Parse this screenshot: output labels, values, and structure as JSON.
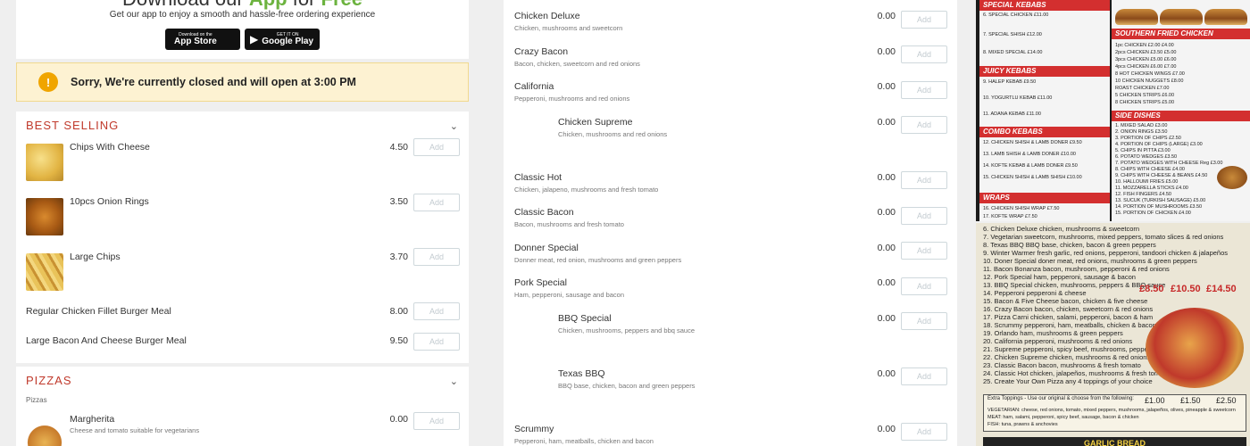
{
  "app_banner": {
    "title_prefix": "Download our",
    "title_app": "App",
    "title_mid": "for",
    "title_free": "Free",
    "subtitle": "Get our app to enjoy a smooth and hassle-free ordering experience",
    "app_store_small": "Download on the",
    "app_store_big": "App Store",
    "google_small": "GET IT ON",
    "google_big": "Google Play"
  },
  "alert": {
    "icon": "!",
    "text": "Sorry, We're currently closed and will open at 3:00 PM"
  },
  "add_label": "Add",
  "best_selling": {
    "title": "BEST SELLING",
    "items": [
      {
        "name": "Chips With Cheese",
        "price": "4.50",
        "thumb": "cheese"
      },
      {
        "name": "10pcs Onion Rings",
        "price": "3.50",
        "thumb": "rings"
      },
      {
        "name": "Large Chips",
        "price": "3.70",
        "thumb": "chips"
      },
      {
        "name": "Regular Chicken Fillet Burger Meal",
        "price": "8.00"
      },
      {
        "name": "Large Bacon And Cheese Burger Meal",
        "price": "9.50"
      }
    ]
  },
  "pizzas": {
    "title": "PIZZAS",
    "subtitle": "Pizzas",
    "items": [
      {
        "name": "Margherita",
        "desc": "Cheese and tomato suitable for vegetarians",
        "price": "0.00"
      }
    ]
  },
  "middle_items": [
    {
      "name": "Chicken Deluxe",
      "desc": "Chicken, mushrooms and sweetcorn",
      "price": "0.00"
    },
    {
      "name": "Crazy Bacon",
      "desc": "Bacon, chicken, sweetcorn and red onions",
      "price": "0.00"
    },
    {
      "name": "California",
      "desc": "Pepperoni, mushrooms and red onions",
      "price": "0.00"
    },
    {
      "name": "Chicken Supreme",
      "desc": "Chicken, mushrooms and red onions",
      "price": "0.00"
    },
    {
      "name": "Classic Hot",
      "desc": "Chicken, jalapeno, mushrooms and fresh tomato",
      "price": "0.00"
    },
    {
      "name": "Classic Bacon",
      "desc": "Bacon, mushrooms and fresh tomato",
      "price": "0.00"
    },
    {
      "name": "Donner Special",
      "desc": "Donner meat, red onion, mushrooms and green peppers",
      "price": "0.00"
    },
    {
      "name": "Pork Special",
      "desc": "Ham, pepperoni, sausage and bacon",
      "price": "0.00"
    },
    {
      "name": "BBQ Special",
      "desc": "Chicken, mushrooms, peppers and bbq sauce",
      "price": "0.00"
    },
    {
      "name": "Texas BBQ",
      "desc": "BBQ base, chicken, bacon and green peppers",
      "price": "0.00"
    },
    {
      "name": "Scrummy",
      "desc": "Pepperoni, ham, meatballs, chicken and bacon",
      "price": "0.00"
    }
  ],
  "menu_image_top": {
    "left_bands": [
      "SPECIAL KEBABS",
      "JUICY KEBABS",
      "COMBO KEBABS",
      "WRAPS"
    ],
    "left_lines": [
      "6. SPECIAL CHICKEN  £11.00",
      "7. SPECIAL SHISH  £12.00",
      "8. MIXED SPECIAL  £14.00",
      "9. HALEP KEBAB  £9.50",
      "10. YOGURTLU KEBAB  £11.00",
      "11. ADANA KEBAB  £11.00",
      "12. CHICKEN SHISH & LAMB DONER  £9.50",
      "13. LAMB SHISH & LAMB DONER  £10.00",
      "14. KOFTE KEBAB & LAMB DONER  £9.50",
      "15. CHICKEN SHISH & LAMB SHISH  £10.00",
      "16. CHICKEN SHISH WRAP  £7.50",
      "17. KOFTE WRAP  £7.50"
    ],
    "right_bands": [
      "SOUTHERN FRIED CHICKEN",
      "SIDE DISHES"
    ],
    "right_lines": [
      "1pc CHICKEN  £2.00  £4.00",
      "2pcs CHICKEN  £3.50  £5.00",
      "3pcs CHICKEN  £5.00  £6.00",
      "4pcs CHICKEN  £6.00  £7.00",
      "8 HOT CHICKEN WINGS  £7.00",
      "10 CHICKEN NUGGETS  £8.00",
      "ROAST CHICKEN  £7.00",
      "5 CHICKEN STRIPS  £6.00",
      "8 CHICKEN STRIPS  £5.00",
      "1. MIXED SALAD  £3.00",
      "2. ONION RINGS  £3.50",
      "3. PORTION OF CHIPS  £2.50",
      "4. PORTION OF CHIPS (LARGE)  £3.00",
      "5. CHIPS IN PITTA  £3.00",
      "6. POTATO WEDGES  £3.50",
      "7. POTATO WEDGES WITH CHEESE  Reg £3.00",
      "8. CHIPS WITH CHEESE  £4.00",
      "9. CHIPS WITH CHEESE & BEANS  £4.50",
      "10. HALLOUMI FRIES  £5.00",
      "11. MOZZARELLA STICKS  £4.00",
      "12. FISH FINGERS  £4.50",
      "13. SUCUK (TURKISH SAUSAGE)  £5.00",
      "14. PORTION OF MUSHROOMS  £3.50",
      "15. PORTION OF CHICKEN  £4.00"
    ]
  },
  "menu_image_bottom": {
    "lines": [
      "6. Chicken Deluxe chicken, mushrooms & sweetcorn",
      "7. Vegetarian sweetcorn, mushrooms, mixed peppers, tomato slices & red onions",
      "8. Texas BBQ BBQ base, chicken, bacon & green peppers",
      "9. Winter Warmer fresh garlic, red onions, pepperoni, tandoori chicken & jalapeños",
      "10. Doner Special doner meat, red onions, mushrooms & green peppers",
      "11. Bacon Bonanza bacon, mushroom, pepperoni & red onions",
      "12. Pork Special ham, pepperoni, sausage & bacon",
      "13. BBQ Special chicken, mushrooms, peppers & BBQ sauce",
      "14. Pepperoni pepperoni & cheese",
      "15. Bacon & Five Cheese bacon, chicken & five cheese",
      "16. Crazy Bacon bacon, chicken, sweetcorn & red onions",
      "17. Pizza Carni chicken, salami, pepperoni, bacon & ham",
      "18. Scrummy pepperoni, ham, meatballs, chicken & bacon",
      "19. Orlando ham, mushrooms & green peppers",
      "20. California pepperoni, mushrooms & red onions",
      "21. Supreme pepperoni, spicy beef, mushrooms, peppers & red onions",
      "22. Chicken Supreme chicken, mushrooms & red onions",
      "23. Classic Bacon bacon, mushrooms & fresh tomato",
      "24. Classic Hot chicken, jalapeños, mushrooms & fresh tomato",
      "25. Create Your Own Pizza any 4 toppings of your choice"
    ],
    "prices": [
      "£8.50",
      "£10.50",
      "£14.50"
    ],
    "extra_title": "Extra Toppings - Use our original & choose from the following:",
    "extra_prices": [
      "£1.00",
      "£1.50",
      "£2.50"
    ],
    "extra_veg": "VEGETARIAN: cheese, red onions, tomato, mixed peppers, mushrooms, jalapeños, olives, pineapple & sweetcorn",
    "extra_meat": "MEAT: ham, salami, pepperoni, spicy beef, sausage, bacon & chicken",
    "extra_fish": "FISH: tuna, prawns & anchovies",
    "garlic": "GARLIC BREAD"
  }
}
